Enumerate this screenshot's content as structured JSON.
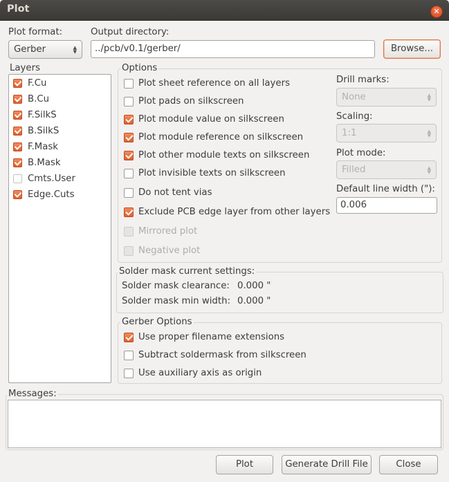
{
  "window": {
    "title": "Plot"
  },
  "top": {
    "plot_format_label": "Plot format:",
    "plot_format_value": "Gerber",
    "output_dir_label": "Output directory:",
    "output_dir_value": "../pcb/v0.1/gerber/",
    "browse_label": "Browse..."
  },
  "layers": {
    "title": "Layers",
    "items": [
      {
        "label": "F.Cu",
        "checked": true
      },
      {
        "label": "B.Cu",
        "checked": true
      },
      {
        "label": "F.SilkS",
        "checked": true
      },
      {
        "label": "B.SilkS",
        "checked": true
      },
      {
        "label": "F.Mask",
        "checked": true
      },
      {
        "label": "B.Mask",
        "checked": true
      },
      {
        "label": "Cmts.User",
        "checked": false
      },
      {
        "label": "Edge.Cuts",
        "checked": true
      }
    ]
  },
  "options": {
    "title": "Options",
    "items": [
      {
        "label": "Plot sheet reference on all layers",
        "checked": false,
        "disabled": false
      },
      {
        "label": "Plot pads on silkscreen",
        "checked": false,
        "disabled": false
      },
      {
        "label": "Plot module value on silkscreen",
        "checked": true,
        "disabled": false
      },
      {
        "label": "Plot module reference on silkscreen",
        "checked": true,
        "disabled": false
      },
      {
        "label": "Plot other module texts on silkscreen",
        "checked": true,
        "disabled": false
      },
      {
        "label": "Plot invisible texts on silkscreen",
        "checked": false,
        "disabled": false
      },
      {
        "label": "Do not tent vias",
        "checked": false,
        "disabled": false
      },
      {
        "label": "Exclude PCB edge layer from other layers",
        "checked": true,
        "disabled": false
      },
      {
        "label": "Mirrored plot",
        "checked": false,
        "disabled": true
      },
      {
        "label": "Negative plot",
        "checked": false,
        "disabled": true
      }
    ],
    "drill_marks_label": "Drill marks:",
    "drill_marks_value": "None",
    "scaling_label": "Scaling:",
    "scaling_value": "1:1",
    "plot_mode_label": "Plot mode:",
    "plot_mode_value": "Filled",
    "line_width_label": "Default line width (\"):",
    "line_width_value": "0.006"
  },
  "solder_mask": {
    "title": "Solder mask current settings:",
    "clearance_label": "Solder mask clearance:",
    "clearance_value": "0.000 \"",
    "min_width_label": "Solder mask min width:",
    "min_width_value": "0.000 \""
  },
  "gerber": {
    "title": "Gerber Options",
    "items": [
      {
        "label": "Use proper filename extensions",
        "checked": true
      },
      {
        "label": "Subtract soldermask from silkscreen",
        "checked": false
      },
      {
        "label": "Use auxiliary axis as origin",
        "checked": false
      }
    ]
  },
  "messages": {
    "title": "Messages:"
  },
  "buttons": {
    "plot": "Plot",
    "drill": "Generate Drill File",
    "close": "Close"
  }
}
